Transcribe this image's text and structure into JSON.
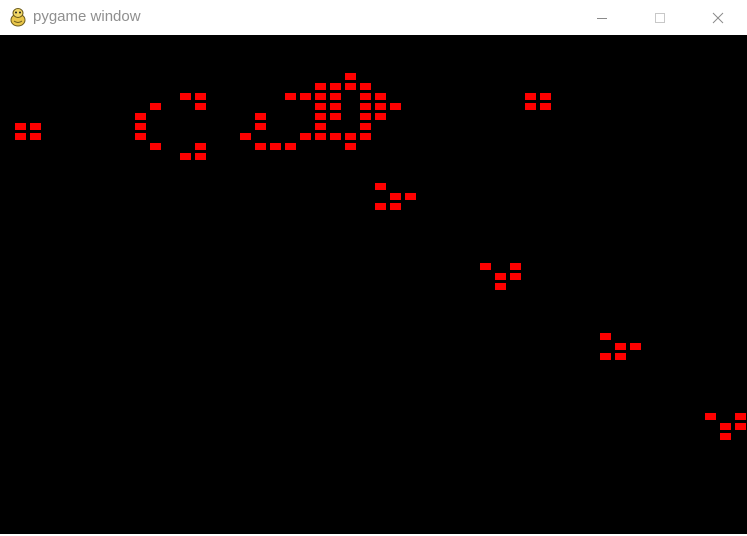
{
  "window": {
    "title": "pygame window",
    "icon": "pygame-snake-icon",
    "controls": [
      "minimize-icon",
      "maximize-icon",
      "close-icon"
    ]
  },
  "game": {
    "type": "Conway's Game of Life grid",
    "cell_color": "#ff0000",
    "background_color": "#000000",
    "grid_cell_size": [
      15,
      10
    ],
    "live_cells": [
      [
        1,
        8
      ],
      [
        2,
        8
      ],
      [
        1,
        9
      ],
      [
        2,
        9
      ],
      [
        9,
        7
      ],
      [
        9,
        8
      ],
      [
        9,
        9
      ],
      [
        10,
        6
      ],
      [
        10,
        10
      ],
      [
        12,
        5
      ],
      [
        13,
        5
      ],
      [
        13,
        6
      ],
      [
        12,
        11
      ],
      [
        13,
        11
      ],
      [
        13,
        10
      ],
      [
        16,
        9
      ],
      [
        17,
        7
      ],
      [
        17,
        8
      ],
      [
        17,
        10
      ],
      [
        18,
        10
      ],
      [
        19,
        10
      ],
      [
        19,
        5
      ],
      [
        20,
        5
      ],
      [
        20,
        9
      ],
      [
        21,
        4
      ],
      [
        21,
        5
      ],
      [
        21,
        6
      ],
      [
        21,
        7
      ],
      [
        21,
        8
      ],
      [
        21,
        9
      ],
      [
        22,
        4
      ],
      [
        22,
        5
      ],
      [
        22,
        6
      ],
      [
        22,
        7
      ],
      [
        22,
        9
      ],
      [
        23,
        3
      ],
      [
        23,
        4
      ],
      [
        23,
        9
      ],
      [
        23,
        10
      ],
      [
        24,
        4
      ],
      [
        24,
        5
      ],
      [
        24,
        6
      ],
      [
        24,
        7
      ],
      [
        24,
        8
      ],
      [
        24,
        9
      ],
      [
        25,
        5
      ],
      [
        25,
        6
      ],
      [
        25,
        7
      ],
      [
        26,
        6
      ],
      [
        35,
        5
      ],
      [
        36,
        5
      ],
      [
        35,
        6
      ],
      [
        36,
        6
      ],
      [
        25,
        14
      ],
      [
        26,
        15
      ],
      [
        27,
        15
      ],
      [
        25,
        16
      ],
      [
        26,
        16
      ],
      [
        32,
        22
      ],
      [
        33,
        23
      ],
      [
        34,
        22
      ],
      [
        34,
        23
      ],
      [
        33,
        24
      ],
      [
        40,
        29
      ],
      [
        41,
        30
      ],
      [
        42,
        30
      ],
      [
        40,
        31
      ],
      [
        41,
        31
      ],
      [
        47,
        37
      ],
      [
        48,
        38
      ],
      [
        49,
        37
      ],
      [
        49,
        38
      ],
      [
        48,
        39
      ]
    ]
  }
}
